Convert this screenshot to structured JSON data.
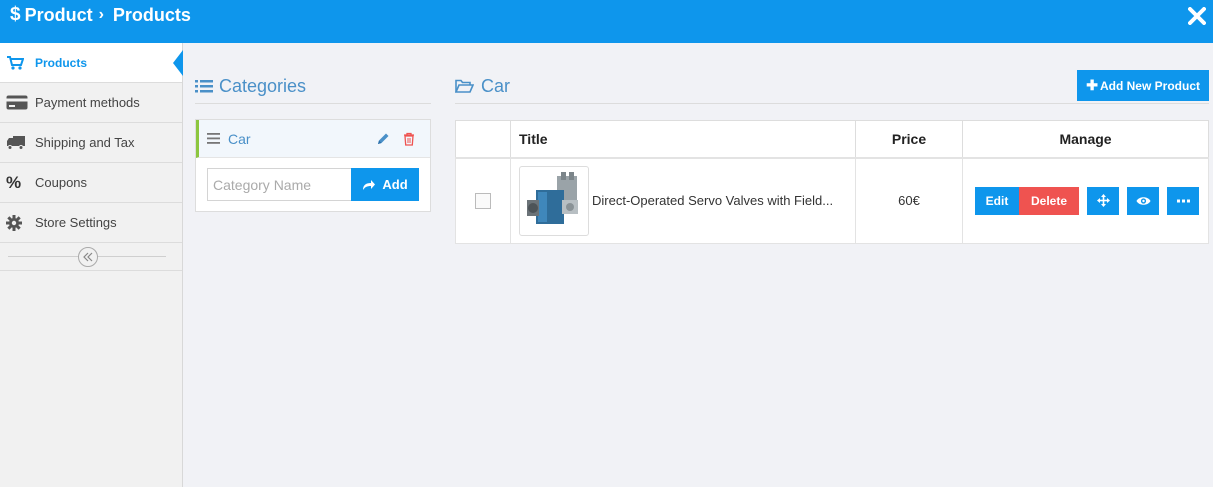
{
  "header": {
    "crumb_root": "Product",
    "crumb_current": "Products"
  },
  "sidebar": {
    "items": [
      {
        "label": "Products",
        "icon": "cart-icon"
      },
      {
        "label": "Payment methods",
        "icon": "credit-card-icon"
      },
      {
        "label": "Shipping and Tax",
        "icon": "truck-icon"
      },
      {
        "label": "Coupons",
        "icon": "percent-icon"
      },
      {
        "label": "Store Settings",
        "icon": "gear-icon"
      }
    ]
  },
  "categories": {
    "heading": "Categories",
    "items": [
      {
        "name": "Car"
      }
    ],
    "new_placeholder": "Category Name",
    "add_label": "Add"
  },
  "products": {
    "heading": "Car",
    "add_new_label": "Add New Product",
    "columns": {
      "title": "Title",
      "price": "Price",
      "manage": "Manage"
    },
    "rows": [
      {
        "title": "Direct-Operated Servo Valves with Field...",
        "price": "60€",
        "edit_label": "Edit",
        "delete_label": "Delete"
      }
    ]
  },
  "colors": {
    "accent": "#0e96ec",
    "danger": "#ef5350",
    "category_marker": "#8cc63f",
    "heading_text": "#4a90c8"
  }
}
